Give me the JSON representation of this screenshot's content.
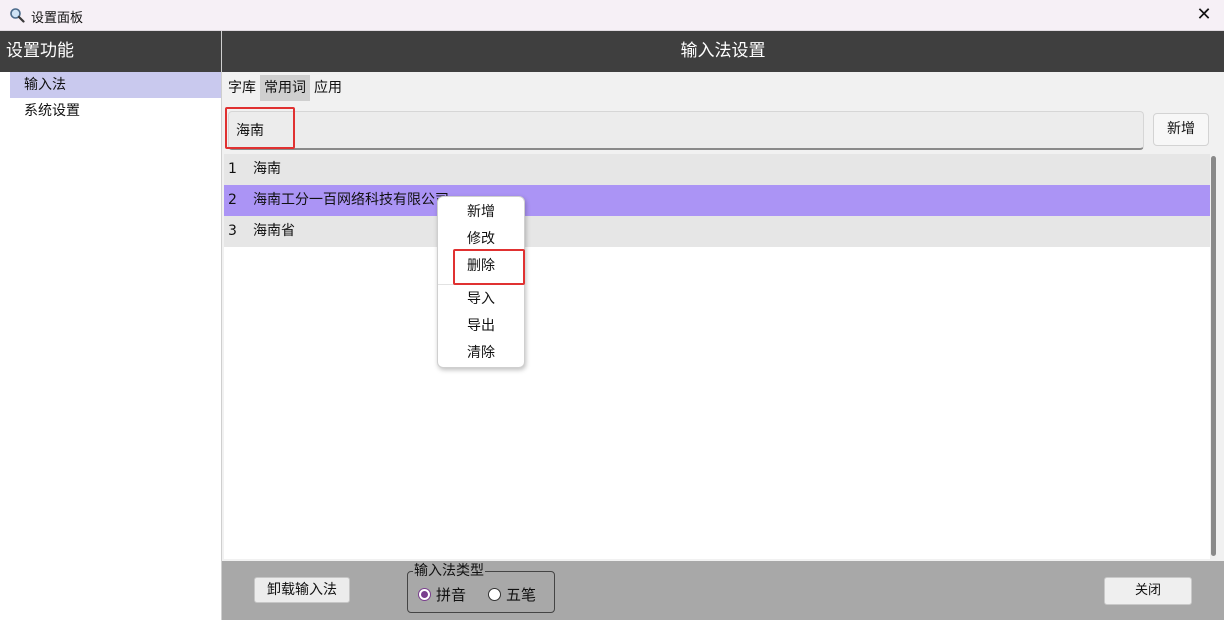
{
  "window": {
    "title": "设置面板",
    "app_icon": "magnifier-icon",
    "close_glyph": "✕"
  },
  "sidebar": {
    "header": "设置功能",
    "items": [
      {
        "label": "输入法",
        "active": true
      },
      {
        "label": "系统设置",
        "active": false
      }
    ]
  },
  "main": {
    "header": "输入法设置",
    "tabs": [
      {
        "label": "字库",
        "active": false
      },
      {
        "label": "常用词",
        "active": true
      },
      {
        "label": "应用",
        "active": false
      }
    ],
    "search": {
      "value": "海南",
      "placeholder": ""
    },
    "add_button": "新增",
    "rows": [
      {
        "index": "1",
        "text": "海南",
        "selected": false
      },
      {
        "index": "2",
        "text": "海南工分一百网络科技有限公司",
        "selected": true
      },
      {
        "index": "3",
        "text": "海南省",
        "selected": false
      }
    ]
  },
  "context_menu": {
    "items": [
      "新增",
      "修改",
      "删除",
      "导入",
      "导出",
      "清除"
    ],
    "highlighted": "删除"
  },
  "bottom": {
    "uninstall_button": "卸载输入法",
    "ime_type_legend": "输入法类型",
    "radio_options": [
      {
        "label": "拼音",
        "checked": true
      },
      {
        "label": "五笔",
        "checked": false
      }
    ],
    "close_button": "关闭"
  },
  "colors": {
    "header_bg": "#3f3f3f",
    "selected_row": "#ab94f5",
    "sidebar_active": "#c9c9ee",
    "highlight_red": "#e03131",
    "radio_accent": "#7a3e8e"
  }
}
